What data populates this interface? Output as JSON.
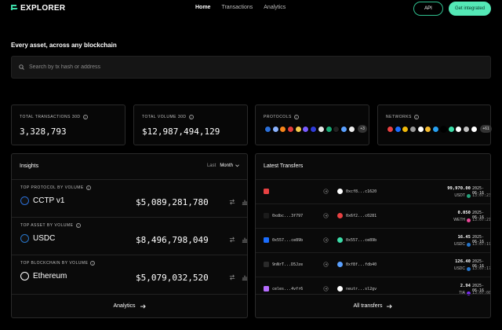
{
  "nav": {
    "logo": "EXPLORER",
    "links": [
      "Home",
      "Transactions",
      "Analytics"
    ],
    "active": "Home",
    "api_label": "API",
    "cta_label": "Get integrated"
  },
  "hero": {
    "tagline": "Every asset, across any blockchain",
    "search_placeholder": "Search by tx hash or address"
  },
  "stats": {
    "transactions": {
      "label": "TOTAL TRANSACTIONS 30D",
      "value": "3,328,793"
    },
    "volume": {
      "label": "TOTAL VOLUME 30D",
      "value": "$12,987,494,129"
    },
    "protocols": {
      "label": "PROTOCOLS",
      "more": "+3",
      "colors": [
        "#2b6fd8",
        "#8bb3ff",
        "#f6851b",
        "#e03c3c",
        "#f2c94c",
        "#7a5cff",
        "#2f3bd6",
        "#e6e6e6",
        "#19a974",
        "#222",
        "#5aa0ff",
        "#eeeeee"
      ]
    },
    "networks": {
      "label": "NETWORKS",
      "more": "+61",
      "colors": [
        "#e84142",
        "#1b6dfd",
        "#f0b90b",
        "#9a9a9a",
        "#ffffff",
        "#f3ba2f",
        "#28a0f0",
        "#000",
        "#3cdca8",
        "#ffffff",
        "#c0c0c0",
        "#ffffff"
      ]
    }
  },
  "insights": {
    "title": "Insights",
    "period_label": "Last",
    "period_value": "Month",
    "rows": [
      {
        "label": "TOP PROTOCOL BY VOLUME",
        "name": "CCTP v1",
        "amount": "$5,089,281,780",
        "icon": "cctp-icon",
        "color": "#2b6fd8"
      },
      {
        "label": "TOP ASSET BY VOLUME",
        "name": "USDC",
        "amount": "$8,496,798,049",
        "icon": "usdc-icon",
        "color": "#2775ca"
      },
      {
        "label": "TOP BLOCKCHAIN BY VOLUME",
        "name": "Ethereum",
        "amount": "$5,079,032,520",
        "icon": "ethereum-icon",
        "color": "#ffffff"
      }
    ],
    "footer": "Analytics"
  },
  "transfers": {
    "title": "Latest Transfers",
    "rows": [
      {
        "src": "",
        "src_color": "#e84142",
        "dst": "0xcf8...c1620",
        "dst_color": "#ffffff",
        "amount": "99,970.00",
        "token": "USDT",
        "token_color": "#26a17b",
        "date": "2025-06-16",
        "time": "13:07:23"
      },
      {
        "src": "0xdbc...3f797",
        "src_color": "#1b1b1b",
        "dst": "0x6f2...c0281",
        "dst_color": "#e84142",
        "amount": "0.050",
        "token": "WETH",
        "token_color": "#ec4899",
        "date": "2025-06-16",
        "time": "13:07:21"
      },
      {
        "src": "0x557...ce89b",
        "src_color": "#1b6dfd",
        "dst": "0x557...ce89b",
        "dst_color": "#3cdca8",
        "amount": "16.45",
        "token": "USDC",
        "token_color": "#2775ca",
        "date": "2025-06-16",
        "time": "13:07:19"
      },
      {
        "src": "9nNrT...D5Jze",
        "src_color": "#2a2a2a",
        "dst": "0xf8f...fdb40",
        "dst_color": "#5aa0ff",
        "amount": "126.40",
        "token": "USDC",
        "token_color": "#2775ca",
        "date": "2025-06-16",
        "time": "13:07:17"
      },
      {
        "src": "celes...4vfr6",
        "src_color": "#b66dff",
        "dst": "neutr...sl2gv",
        "dst_color": "#ffffff",
        "amount": "2.94",
        "token": "TIA",
        "token_color": "#7b2bf9",
        "date": "2025-06-16",
        "time": "13:07:08"
      }
    ],
    "footer": "All transfers"
  }
}
